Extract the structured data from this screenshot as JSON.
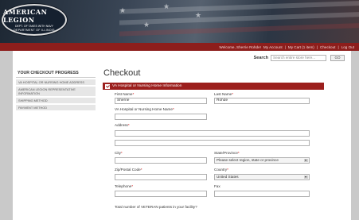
{
  "logo": {
    "line1": "AMERICAN LEGION",
    "line2": "DEPT. OF TAKES WITH NAVY",
    "line3": "DEPARTMENT OF ILLINOIS"
  },
  "topnav": {
    "welcome": "Welcome, Sherrie Rohde!",
    "my_account": "My Account",
    "my_cart": "My Cart (1 item)",
    "checkout": "Checkout",
    "logout": "Log Out",
    "separator": "|"
  },
  "search": {
    "label": "Search",
    "placeholder": "Search entire store here...",
    "button": "GO"
  },
  "sidebar": {
    "title": "YOUR CHECKOUT PROGRESS",
    "items": [
      {
        "label": "VA HOSPITAL OR NURSING HOME ADDRESS"
      },
      {
        "label": "AMERICAN LEGION REPRESENTATIVE INFORMATION"
      },
      {
        "label": "SHIPPING METHOD"
      },
      {
        "label": "PAYMENT METHOD"
      }
    ]
  },
  "main": {
    "title": "Checkout",
    "section_title": "VA Hospital or Nursing Home Information"
  },
  "form": {
    "required_mark": "*",
    "first_name": {
      "label": "First Name",
      "value": "Sherrie"
    },
    "last_name": {
      "label": "Last Name",
      "value": "Rohde"
    },
    "hospital_name": {
      "label": "VA Hospital or Nursing Home Name",
      "value": ""
    },
    "address": {
      "label": "Address",
      "value": ""
    },
    "city": {
      "label": "City",
      "value": ""
    },
    "state": {
      "label": "State/Province",
      "value": "Please select region, state or province"
    },
    "zip": {
      "label": "Zip/Postal Code",
      "value": ""
    },
    "country": {
      "label": "Country",
      "value": "United States"
    },
    "telephone": {
      "label": "Telephone",
      "value": ""
    },
    "fax": {
      "label": "Fax",
      "value": ""
    },
    "veterans_question": "Total number of VETERAN patients in your facility?"
  }
}
